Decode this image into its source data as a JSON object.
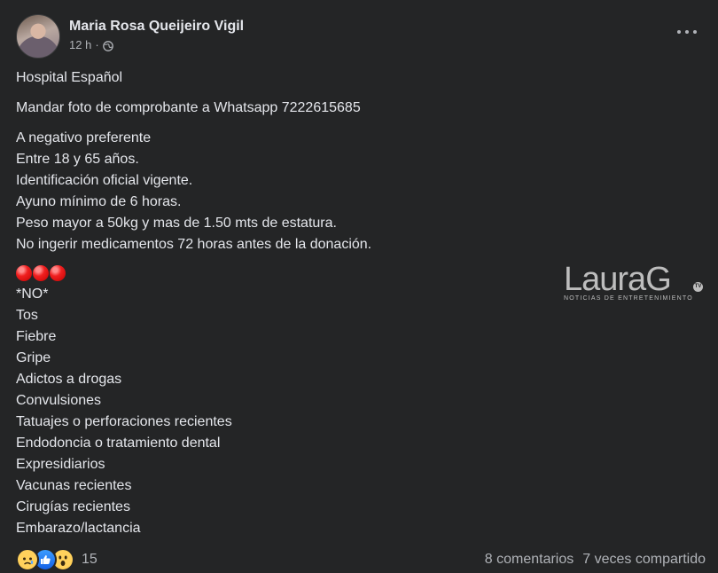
{
  "post": {
    "author": "Maria Rosa Queijeiro Vigil",
    "time": "12 h",
    "separator": "·",
    "privacy_icon": "globe-icon",
    "lines": [
      "Hospital Español",
      "Mandar foto de comprobante a Whatsapp 7222615685",
      "A negativo preferente",
      "Entre 18 y 65 años.",
      "Identificación oficial vigente.",
      "Ayuno mínimo de 6 horas.",
      "Peso mayor a 50kg y mas de 1.50 mts de estatura.",
      "No ingerir medicamentos 72 horas antes de la donación.",
      "*NO*",
      "Tos",
      "Fiebre",
      "Gripe",
      "Adictos a drogas",
      "Convulsiones",
      "Tatuajes o perforaciones recientes",
      "Endodoncia o tratamiento dental",
      "Expresidiarios",
      "Vacunas recientes",
      "Cirugías recientes",
      "Embarazo/lactancia"
    ],
    "emoji": [
      "red-circle",
      "red-circle",
      "red-circle"
    ]
  },
  "watermark": {
    "logo": "LauraG",
    "badge": "TV",
    "tagline": "NOTICIAS DE ENTRETENIMIENTO"
  },
  "footer": {
    "reactions": [
      "sad-icon",
      "like-icon",
      "wow-icon"
    ],
    "reaction_count": "15",
    "comments": "8 comentarios",
    "shares": "7 veces compartido"
  },
  "colors": {
    "background": "#242526",
    "text": "#e4e6eb",
    "secondary": "#b0b3b8"
  }
}
